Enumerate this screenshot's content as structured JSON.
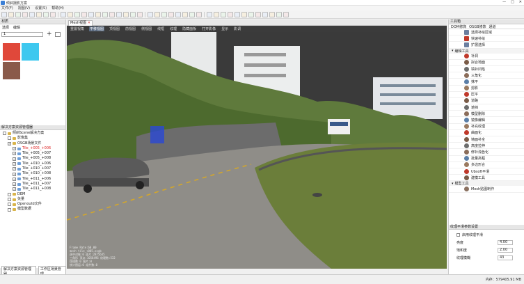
{
  "app": {
    "title": "倾斜摄影方案"
  },
  "menu": [
    "文件(F)",
    "视图(V)",
    "设置(S)",
    "帮助(H)"
  ],
  "left_panel": {
    "title": "材质",
    "tabs": [
      "选择",
      "编辑"
    ],
    "select_value": "1",
    "swatches": [
      "#e0483a",
      "#3ec8ef",
      "#8a5a4a"
    ]
  },
  "tree_panel": {
    "title": "解决方案资源管理器",
    "items": [
      {
        "label": "倾斜Scene解决方案",
        "depth": 0,
        "cb": "",
        "kind": "root"
      },
      {
        "label": "影像集",
        "depth": 1,
        "cb": "",
        "kind": "folder"
      },
      {
        "label": "OSGB场景文件",
        "depth": 1,
        "cb": "✓",
        "kind": "folder"
      },
      {
        "label": "Tile_+005_+006",
        "depth": 2,
        "cb": "✓",
        "kind": "item",
        "red": true
      },
      {
        "label": "Tile_+005_+007",
        "depth": 2,
        "cb": "✓",
        "kind": "item"
      },
      {
        "label": "Tile_+005_+008",
        "depth": 2,
        "cb": "✓",
        "kind": "item"
      },
      {
        "label": "Tile_+010_+006",
        "depth": 2,
        "cb": "✓",
        "kind": "item"
      },
      {
        "label": "Tile_+010_+007",
        "depth": 2,
        "cb": "✓",
        "kind": "item"
      },
      {
        "label": "Tile_+010_+008",
        "depth": 2,
        "cb": "✓",
        "kind": "item"
      },
      {
        "label": "Tile_+011_+006",
        "depth": 2,
        "cb": "✓",
        "kind": "item"
      },
      {
        "label": "Tile_+011_+007",
        "depth": 2,
        "cb": "✓",
        "kind": "item"
      },
      {
        "label": "Tile_+011_+008",
        "depth": 2,
        "cb": "✓",
        "kind": "item"
      },
      {
        "label": "DEM",
        "depth": 1,
        "cb": "",
        "kind": "folder"
      },
      {
        "label": "矢量",
        "depth": 1,
        "cb": "",
        "kind": "folder"
      },
      {
        "label": "Openoutd文件",
        "depth": 1,
        "cb": "",
        "kind": "folder"
      },
      {
        "label": "模型数据",
        "depth": 1,
        "cb": "",
        "kind": "folder"
      }
    ],
    "bottom_tabs": [
      "解决方案资源管理器",
      "工作区场景管理"
    ]
  },
  "viewport": {
    "tab": "Mesh视图",
    "subtabs": [
      "重置视角",
      "平移视图",
      "顶视图",
      "前视图",
      "侧视图",
      "线框",
      "纹理",
      "隐藏面板",
      "打开影像",
      "显示",
      "影调"
    ],
    "active_subtab": "平移视图",
    "hud": [
      "Frame Rate:60.00",
      "mesh tile_+005.osgb",
      "选中对象:0  面片:2875645",
      "三角形 顶点:1058496  纹理数:532",
      "纹理数:0  图片:0",
      "统计图层:0  组件数:0"
    ]
  },
  "right_panel": {
    "title": "工具箱",
    "tabs": [
      "DOM修饰",
      "OSGB修饰",
      "通道"
    ],
    "top_items": [
      "选择补绘区域",
      "快速补绘",
      "扩展选择"
    ],
    "group1": "编辑工具",
    "tools": [
      "补洞",
      "拟合地面",
      "填补凹陷",
      "三角化",
      "抹平",
      "剪影",
      "压平",
      "道路",
      "遮挡",
      "模型删除",
      "镜像编辑",
      "补充纹理",
      "曲面化",
      "墙面补全",
      "高度拉伸",
      "修补浅色化",
      "批量高程",
      "多边形合",
      "Ubsoft平滑",
      "建模工具"
    ],
    "group2": "模型工具",
    "last_item": "Mesh贴图制作"
  },
  "props_panel": {
    "title": "纹理平滑参数设置",
    "checkbox": "启用纹理平滑",
    "rows": [
      {
        "label": "亮度",
        "value": "4.00"
      },
      {
        "label": "饱和度",
        "value": "2.00"
      },
      {
        "label": "纹理模糊",
        "value": "43"
      }
    ]
  },
  "status": {
    "text": "内存：579405.91 MB"
  }
}
